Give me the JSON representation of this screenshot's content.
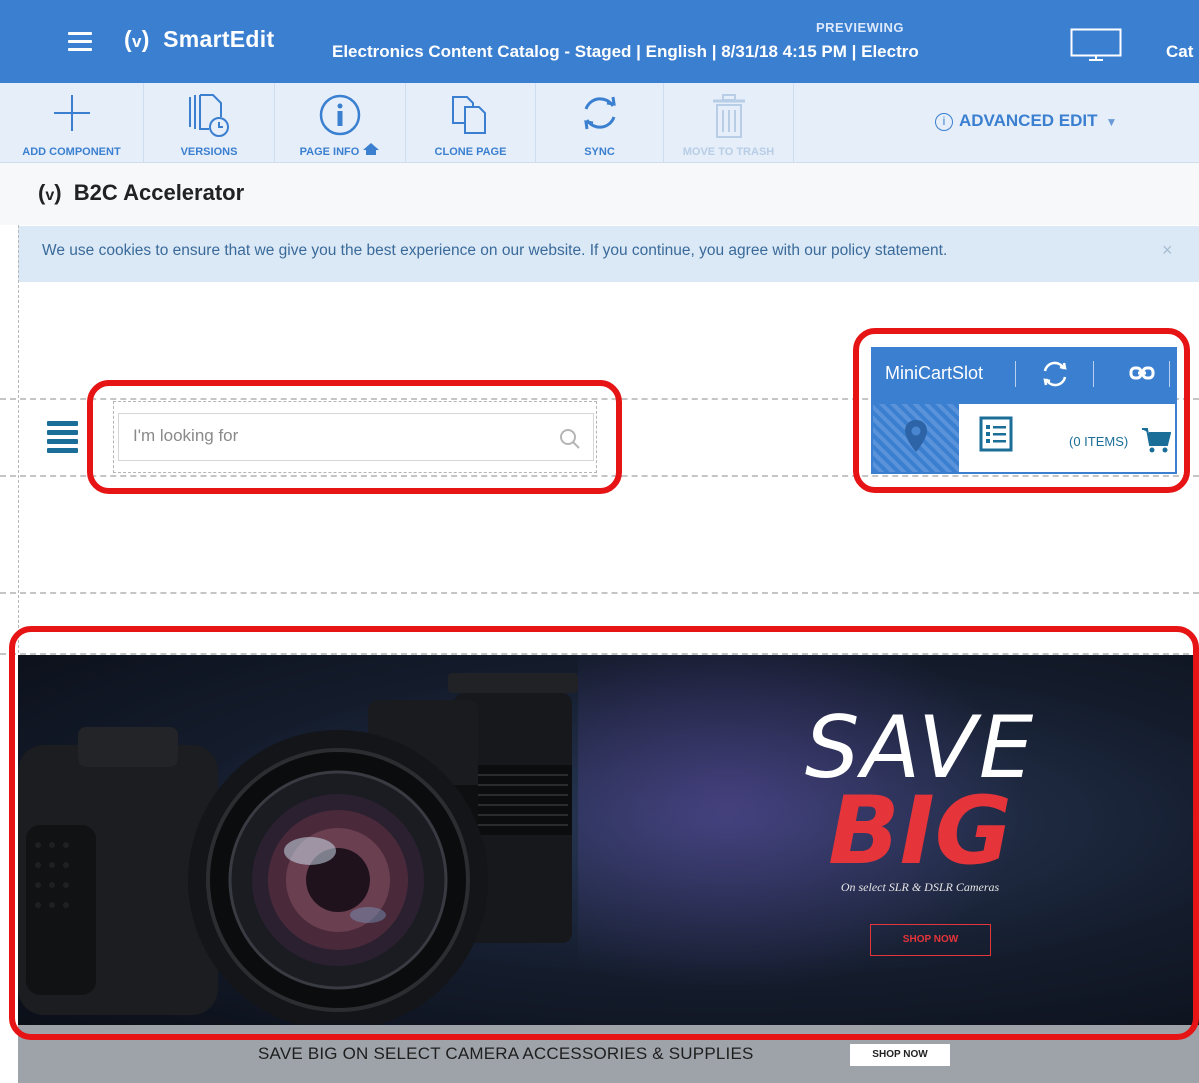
{
  "topbar": {
    "app_name": "SmartEdit",
    "preview_label": "PREVIEWING",
    "preview_info": "Electronics Content Catalog - Staged | English | 8/31/18 4:15 PM | Electro",
    "catalog_label": "Cat"
  },
  "toolbar": {
    "items": [
      {
        "label": "ADD COMPONENT",
        "icon": "plus-icon"
      },
      {
        "label": "VERSIONS",
        "icon": "versions-icon"
      },
      {
        "label": "PAGE INFO",
        "icon": "info-icon"
      },
      {
        "label": "CLONE PAGE",
        "icon": "clone-icon"
      },
      {
        "label": "SYNC",
        "icon": "sync-icon"
      },
      {
        "label": "MOVE TO TRASH",
        "icon": "trash-icon",
        "disabled": true
      }
    ],
    "advanced_edit": "ADVANCED EDIT",
    "accent_color": "#3b7fd0"
  },
  "site": {
    "logo": "B2C Accelerator",
    "cookie_text": "We use cookies to ensure that we give you the best experience on our website. If you continue, you agree with our policy statement.",
    "cookie_close": "×"
  },
  "search": {
    "placeholder": "I'm looking for"
  },
  "minicart": {
    "slot_name": "MiniCartSlot",
    "cart_label": "(0 ITEMS)"
  },
  "banner": {
    "headline_1": "SAVE",
    "headline_2": "BIG",
    "subtext": "On select SLR & DSLR Cameras",
    "cta": "SHOP NOW",
    "accent_color": "#e5343a"
  },
  "promo_strip": {
    "text": "SAVE BIG ON SELECT CAMERA ACCESSORIES & SUPPLIES",
    "cta": "SHOP NOW"
  }
}
